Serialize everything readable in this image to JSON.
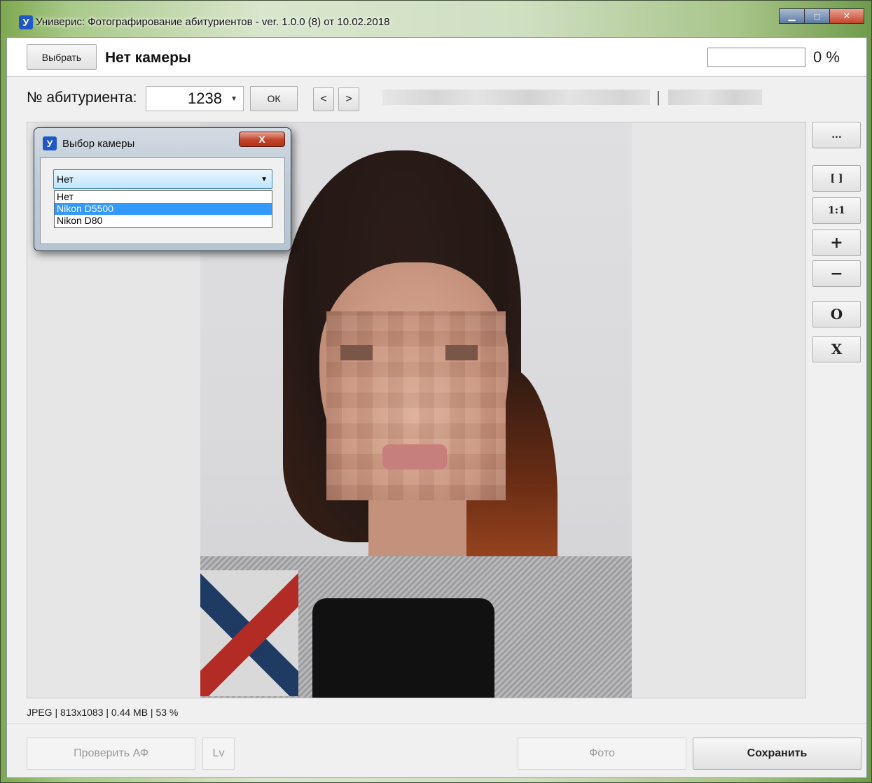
{
  "window": {
    "app_icon": "У",
    "title": "Универис: Фотографирование абитуриентов  -  ver. 1.0.0 (8) от 10.02.2018",
    "minimize": "▁",
    "maximize": "□",
    "close": "✕"
  },
  "header": {
    "select_button": "Выбрать",
    "camera_status": "Нет камеры",
    "progress_value": 0,
    "progress_text": "0 %"
  },
  "applicant": {
    "label": "№ абитуриента:",
    "number": "1238",
    "ok_button": "ОК",
    "prev_button": "<",
    "next_button": ">",
    "separator": "|"
  },
  "tools": [
    "...",
    "[ ]",
    "1:1",
    "+",
    "−",
    "O",
    "X"
  ],
  "status_bar": "JPEG | 813x1083 | 0.44 MB | 53 %",
  "bottom": {
    "check_af": "Проверить АФ",
    "lv": "Lv",
    "photo": "Фото",
    "save": "Сохранить"
  },
  "camera_dialog": {
    "icon": "У",
    "title": "Выбор камеры",
    "close": "X",
    "selected_value": "Нет",
    "options": [
      "Нет",
      "Nikon D5500",
      "Nikon D80"
    ],
    "highlighted_option": "Nikon D5500"
  }
}
